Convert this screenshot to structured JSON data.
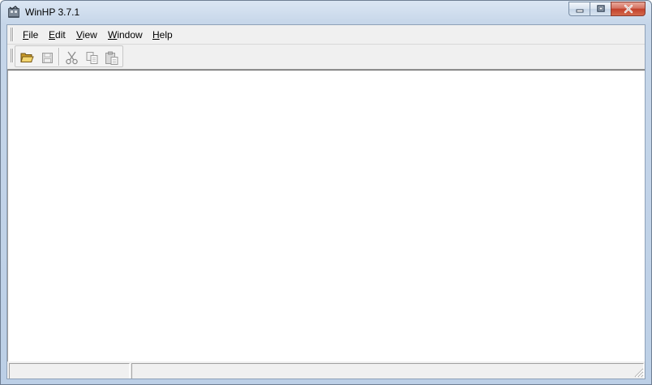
{
  "window": {
    "title": "WinHP 3.7.1"
  },
  "caption_buttons": {
    "minimize_icon": "minimize-icon",
    "maximize_icon": "restore-icon",
    "close_icon": "close-icon"
  },
  "menu": {
    "items": [
      {
        "underline": "F",
        "rest": "ile"
      },
      {
        "underline": "E",
        "rest": "dit"
      },
      {
        "underline": "V",
        "rest": "iew"
      },
      {
        "underline": "W",
        "rest": "indow"
      },
      {
        "underline": "H",
        "rest": "elp"
      }
    ]
  },
  "toolbar": {
    "buttons": [
      {
        "icon": "open-folder-icon",
        "enabled": true
      },
      {
        "icon": "save-icon",
        "enabled": false
      },
      {
        "icon": "cut-icon",
        "enabled": false
      },
      {
        "icon": "copy-icon",
        "enabled": false
      },
      {
        "icon": "paste-icon",
        "enabled": false
      }
    ]
  },
  "statusbar": {
    "pane1": "",
    "pane2": ""
  },
  "colors": {
    "title_bar": "#c6d6e9",
    "close_button": "#c2402b",
    "workspace": "#ffffff",
    "folder": "#e8c250"
  }
}
